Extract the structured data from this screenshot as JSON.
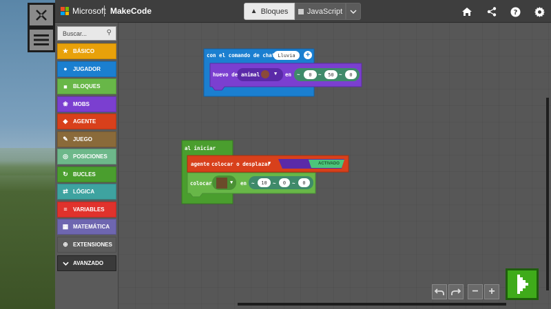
{
  "header": {
    "brand": "Microsoft",
    "app": "MakeCode",
    "tabs": [
      {
        "label": "Bloques",
        "active": true
      },
      {
        "label": "JavaScript",
        "active": false
      }
    ],
    "icons": [
      "home-icon",
      "share-icon",
      "help-icon",
      "settings-icon"
    ]
  },
  "sidebar": {
    "buttons": [
      "close-x-icon",
      "menu-icon"
    ]
  },
  "toolbox": {
    "search_placeholder": "Buscar...",
    "categories": [
      {
        "label": "BÁSICO",
        "color": "#e8a10a",
        "icon": "star-icon"
      },
      {
        "label": "JUGADOR",
        "color": "#1b7fd0",
        "icon": "user-icon"
      },
      {
        "label": "BLOQUES",
        "color": "#68b748",
        "icon": "cube-icon"
      },
      {
        "label": "MOBS",
        "color": "#7b3fd0",
        "icon": "paw-icon"
      },
      {
        "label": "AGENTE",
        "color": "#d8401b",
        "icon": "agent-icon"
      },
      {
        "label": "JUEGO",
        "color": "#8a6a3a",
        "icon": "wrench-icon"
      },
      {
        "label": "POSICIONES",
        "color": "#6db88a",
        "icon": "target-icon"
      },
      {
        "label": "BUCLES",
        "color": "#4a9e2e",
        "icon": "loop-icon"
      },
      {
        "label": "LÓGICA",
        "color": "#3ea3a0",
        "icon": "shuffle-icon"
      },
      {
        "label": "VARIABLES",
        "color": "#e0322c",
        "icon": "list-icon"
      },
      {
        "label": "MATEMÁTICA",
        "color": "#6e66b0",
        "icon": "calculator-icon"
      },
      {
        "label": "EXTENSIONES",
        "color": "#5c5c5c",
        "icon": "plus-circle-icon"
      }
    ],
    "advanced": "AVANZADO"
  },
  "blocks": {
    "chat": {
      "header": "con el comando de chat",
      "command": "Lluvia",
      "spawn_label": "huevo de",
      "animal_label": "animal",
      "en": "en",
      "coords": [
        "0",
        "50",
        "0"
      ],
      "tildes": [
        "~",
        "~",
        "~"
      ]
    },
    "start": {
      "header": "al iniciar",
      "agent_label": "agente",
      "agent_action": "colocar o desplazar",
      "toggle": "ACTIVADO",
      "place_label": "colocar",
      "en": "en",
      "coords": [
        "10",
        "0",
        "0"
      ],
      "tildes": [
        "~",
        "~",
        "~"
      ]
    }
  }
}
